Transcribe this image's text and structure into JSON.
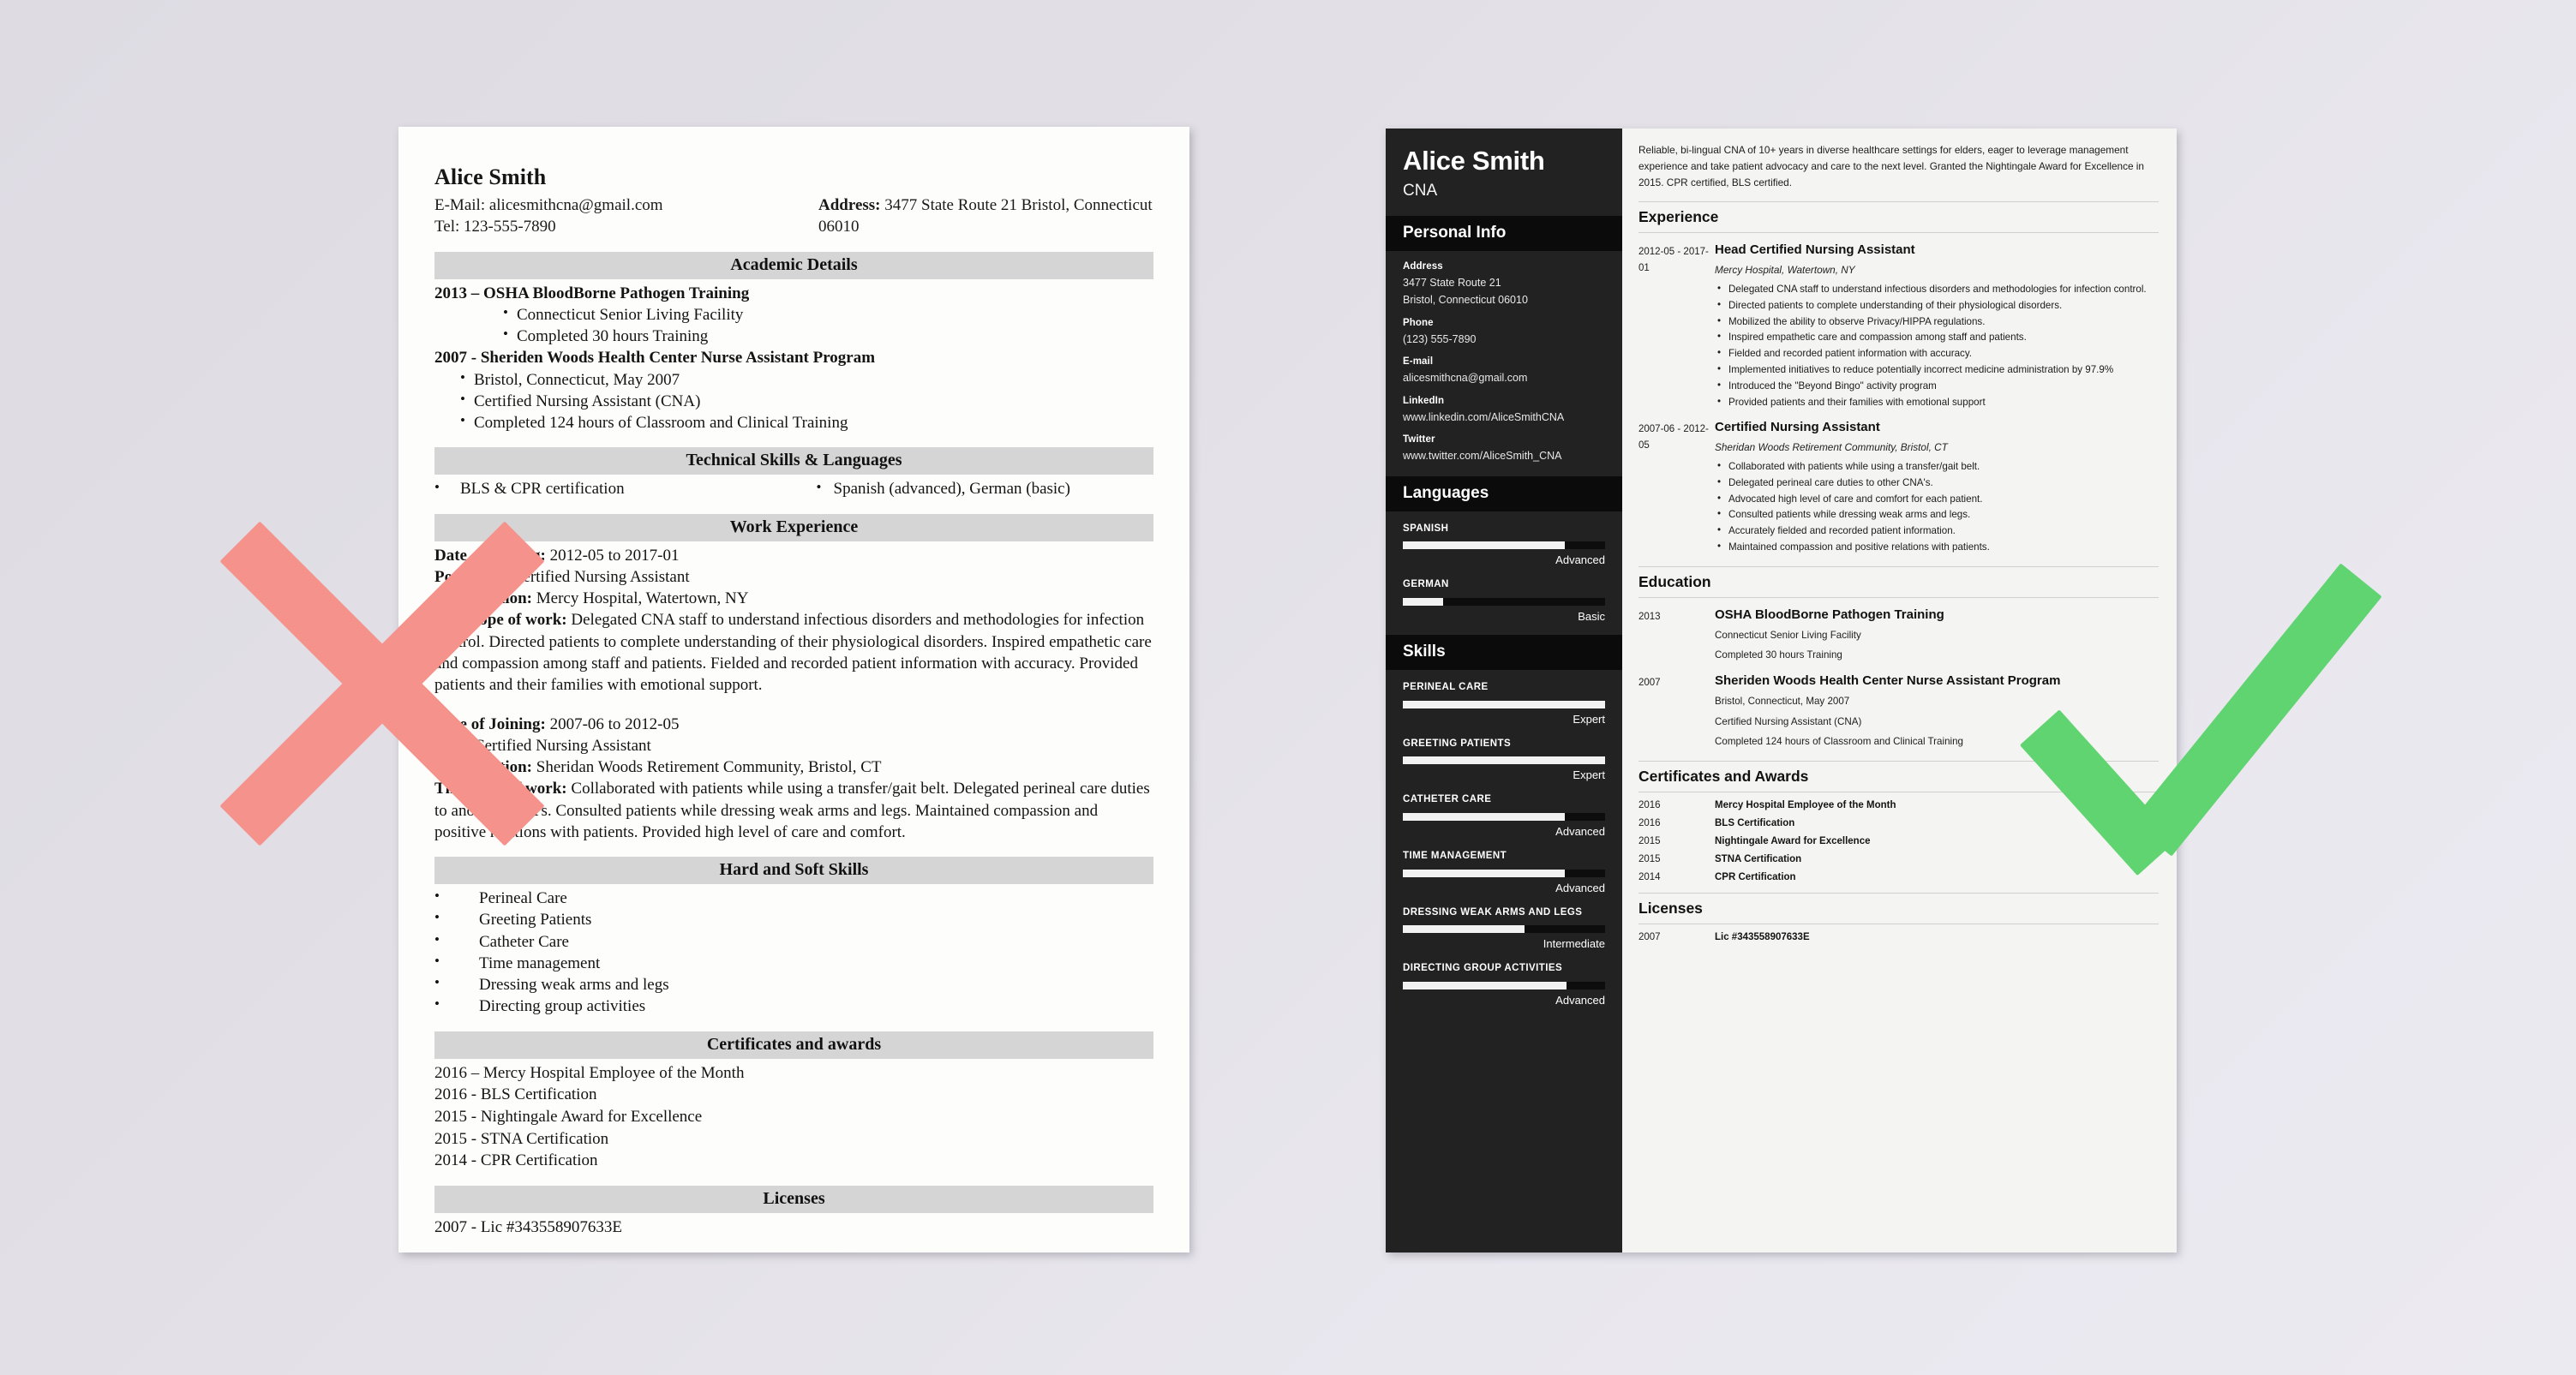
{
  "bad_resume": {
    "name": "Alice Smith",
    "email_line": "E-Mail: alicesmithcna@gmail.com",
    "tel_line": "Tel: 123-555-7890",
    "address_label": "Address:",
    "address_value": "3477 State Route 21 Bristol, Connecticut 06010",
    "sections": {
      "academic": "Academic Details",
      "technical": "Technical Skills & Languages",
      "work": "Work Experience",
      "skills": "Hard and Soft Skills",
      "certificates": "Certificates and awards",
      "licenses": "Licenses"
    },
    "academic": [
      {
        "heading": "2013 – OSHA BloodBorne Pathogen Training",
        "bullets": [
          "Connecticut Senior Living Facility",
          "Completed 30 hours Training"
        ]
      },
      {
        "heading": "2007 - Sheriden Woods Health Center Nurse Assistant Program",
        "bullets": [
          "Bristol, Connecticut, May 2007",
          "Certified Nursing Assistant (CNA)",
          "Completed 124 hours of Classroom and Clinical Training"
        ]
      }
    ],
    "technical": [
      "BLS & CPR certification",
      "Spanish (advanced), German (basic)"
    ],
    "work": [
      {
        "date_label": "Date of Joining:",
        "date_value": "2012-05 to 2017-01",
        "post_label": "Post:",
        "post_value": "Head Certified Nursing Assistant",
        "org_label": "Organization:",
        "org_value": "Mercy Hospital, Watertown, NY",
        "scope_label": "The scope of work:",
        "scope_value": "Delegated CNA staff to understand infectious disorders and methodologies for infection control. Directed patients to complete understanding of their physiological disorders. Inspired empathetic care and compassion among staff and patients. Fielded and recorded patient information with accuracy. Provided patients and their families with emotional support."
      },
      {
        "date_label": "Date of Joining:",
        "date_value": "2007-06 to 2012-05",
        "post_label": "Post:",
        "post_value": "Certified Nursing Assistant",
        "org_label": "Organization:",
        "org_value": "Sheridan Woods Retirement Community, Bristol, CT",
        "scope_label": "The scope of work:",
        "scope_value": "Collaborated with patients while using a transfer/gait belt. Delegated perineal care duties to another CNA’s. Consulted patients while dressing weak arms and legs. Maintained compassion and positive relations with patients. Provided high level of care and comfort."
      }
    ],
    "soft_skills": [
      "Perineal Care",
      "Greeting Patients",
      "Catheter Care",
      "Time management",
      "Dressing weak arms and legs",
      "Directing group activities"
    ],
    "certificates": [
      "2016 – Mercy Hospital Employee of the Month",
      "2016 - BLS Certification",
      "2015 - Nightingale Award for Excellence",
      "2015 - STNA Certification",
      "2014 - CPR Certification"
    ],
    "licenses": [
      "2007 - Lic #343558907633E"
    ]
  },
  "good_resume": {
    "sidebar": {
      "name": "Alice Smith",
      "title": "CNA",
      "personal_info_heading": "Personal Info",
      "fields": [
        {
          "label": "Address",
          "value": "3477 State Route 21"
        },
        {
          "label": "",
          "value": "Bristol, Connecticut 06010"
        },
        {
          "label": "Phone",
          "value": "(123) 555-7890"
        },
        {
          "label": "E-mail",
          "value": "alicesmithcna@gmail.com"
        },
        {
          "label": "LinkedIn",
          "value": "www.linkedin.com/AliceSmithCNA"
        },
        {
          "label": "Twitter",
          "value": "www.twitter.com/AliceSmith_CNA"
        }
      ],
      "languages_heading": "Languages",
      "languages": [
        {
          "name": "SPANISH",
          "level": "Advanced",
          "pct": 80
        },
        {
          "name": "GERMAN",
          "level": "Basic",
          "pct": 20
        }
      ],
      "skills_heading": "Skills",
      "skills": [
        {
          "name": "PERINEAL CARE",
          "level": "Expert",
          "pct": 100
        },
        {
          "name": "GREETING PATIENTS",
          "level": "Expert",
          "pct": 100
        },
        {
          "name": "CATHETER CARE",
          "level": "Advanced",
          "pct": 80
        },
        {
          "name": "TIME MANAGEMENT",
          "level": "Advanced",
          "pct": 80
        },
        {
          "name": "DRESSING WEAK ARMS AND LEGS",
          "level": "Intermediate",
          "pct": 60
        },
        {
          "name": "DIRECTING GROUP ACTIVITIES",
          "level": "Advanced",
          "pct": 81
        }
      ]
    },
    "main": {
      "summary": "Reliable, bi-lingual CNA of 10+ years in diverse healthcare settings for elders, eager to leverage management experience and take patient advocacy and care to the next level. Granted the Nightingale Award for Excellence in 2015. CPR certified, BLS certified.",
      "experience_heading": "Experience",
      "experience": [
        {
          "date": "2012-05 - 2017-01",
          "role": "Head Certified Nursing Assistant",
          "org": "Mercy Hospital, Watertown, NY",
          "bullets": [
            "Delegated CNA staff to understand infectious disorders and methodologies for infection control.",
            "Directed patients to complete understanding of their physiological disorders.",
            "Mobilized the ability to observe Privacy/HIPPA regulations.",
            "Inspired empathetic care and compassion among staff and patients.",
            "Fielded and recorded patient information with accuracy.",
            "Implemented initiatives to reduce potentially incorrect medicine administration by 97.9%",
            "Introduced the \"Beyond Bingo\" activity program",
            "Provided patients and their families with emotional support"
          ]
        },
        {
          "date": "2007-06 - 2012-05",
          "role": "Certified Nursing Assistant",
          "org": "Sheridan Woods Retirement Community, Bristol, CT",
          "bullets": [
            "Collaborated with patients while using a transfer/gait belt.",
            "Delegated perineal care duties to other CNA's.",
            "Advocated high level of care and comfort for each patient.",
            "Consulted patients while dressing weak arms and legs.",
            "Accurately fielded and recorded patient information.",
            "Maintained compassion and positive relations with patients."
          ]
        }
      ],
      "education_heading": "Education",
      "education": [
        {
          "date": "2013",
          "role": "OSHA BloodBorne Pathogen Training",
          "subs": [
            "Connecticut Senior Living Facility",
            "Completed 30 hours Training"
          ]
        },
        {
          "date": "2007",
          "role": "Sheriden Woods Health Center Nurse Assistant Program",
          "subs": [
            "Bristol, Connecticut, May 2007",
            "Certified Nursing Assistant (CNA)",
            "Completed 124 hours of Classroom and Clinical Training"
          ]
        }
      ],
      "certificates_heading": "Certificates and Awards",
      "certificates": [
        {
          "year": "2016",
          "text": "Mercy Hospital Employee of the Month"
        },
        {
          "year": "2016",
          "text": "BLS Certification"
        },
        {
          "year": "2015",
          "text": "Nightingale Award for Excellence"
        },
        {
          "year": "2015",
          "text": "STNA Certification"
        },
        {
          "year": "2014",
          "text": "CPR Certification"
        }
      ],
      "licenses_heading": "Licenses",
      "licenses": [
        {
          "year": "2007",
          "text": "Lic #343558907633E"
        }
      ]
    }
  },
  "marks": {
    "reject_icon": "red-x-mark",
    "approve_icon": "green-check-mark",
    "reject_color": "#f5928c",
    "approve_color": "#5fd470"
  }
}
